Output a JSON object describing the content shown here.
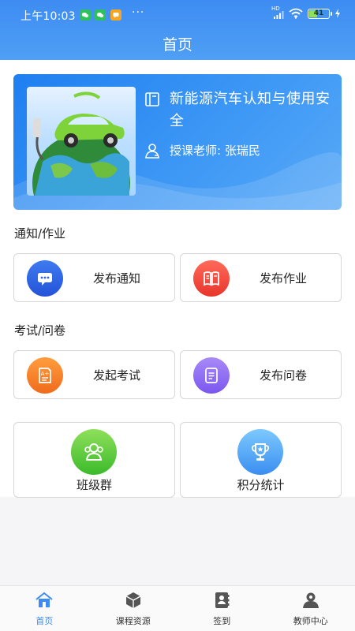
{
  "status_bar": {
    "time": "上午10:03",
    "more": "···",
    "network": "HD",
    "battery": "41",
    "battery_level": 0.41
  },
  "header": {
    "title": "首页"
  },
  "course": {
    "title": "新能源汽车认知与使用安全",
    "teacher_label": "授课老师",
    "teacher_name": "张瑞民"
  },
  "sections": {
    "notice_homework": {
      "title": "通知/作业",
      "items": [
        {
          "label": "发布通知",
          "icon": "message-icon",
          "color": "#2f62e0"
        },
        {
          "label": "发布作业",
          "icon": "notebook-icon",
          "color": "#f04a3c"
        }
      ]
    },
    "exam_survey": {
      "title": "考试/问卷",
      "items": [
        {
          "label": "发起考试",
          "icon": "exam-paper-icon",
          "color": "#f47e2b"
        },
        {
          "label": "发布问卷",
          "icon": "survey-icon",
          "color": "#8a67f2"
        }
      ]
    },
    "extras": {
      "items": [
        {
          "label": "班级群",
          "icon": "group-icon",
          "color": "#56c43a"
        },
        {
          "label": "积分统计",
          "icon": "trophy-icon",
          "color": "#4aa2f5"
        }
      ]
    }
  },
  "bottom_nav": {
    "items": [
      {
        "label": "首页",
        "icon": "home-icon",
        "active": true
      },
      {
        "label": "课程资源",
        "icon": "cube-icon",
        "active": false
      },
      {
        "label": "签到",
        "icon": "contacts-book-icon",
        "active": false
      },
      {
        "label": "教师中心",
        "icon": "user-icon",
        "active": false
      }
    ]
  },
  "colors": {
    "primary": "#3d8cf2"
  }
}
